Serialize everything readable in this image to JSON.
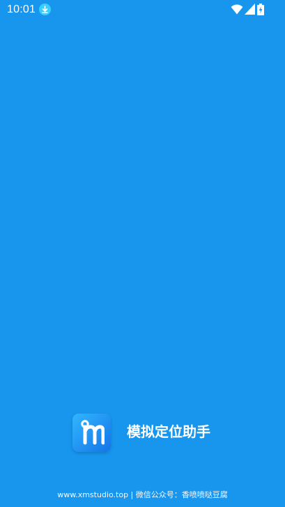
{
  "status_bar": {
    "time": "10:01",
    "icons": [
      "download-icon",
      "wifi-icon",
      "signal-icon",
      "battery-icon"
    ]
  },
  "splash": {
    "background_color": "#1896ee",
    "logo_icon": "app-logo-m-pin-icon",
    "app_name": "模拟定位助手"
  },
  "footer": {
    "text": "www.xmstudio.top | 微信公众号：香喷喷哒豆腐"
  }
}
